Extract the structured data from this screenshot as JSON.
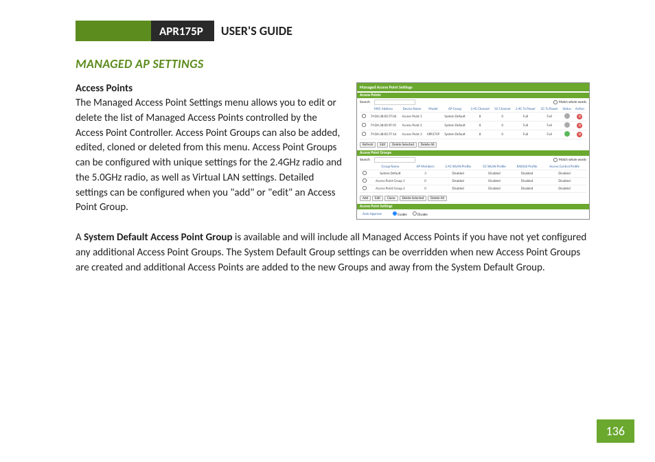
{
  "header": {
    "product": "APR175P",
    "title": "USER'S GUIDE"
  },
  "section_title": "MANAGED AP SETTINGS",
  "subhead": "Access Points",
  "para1": "The Managed Access Point Settings menu allows you to edit or delete the list of Managed Access Points controlled by the Access Point Controller. Access Point Groups can also be added, edited, cloned or deleted from this menu. Access Point Groups can be configured with unique settings for the 2.4GHz radio and the 5.0GHz radio, as well as Virtual LAN settings. Detailed settings can be configured when you \"add\" or \"edit\" an Access Point Group.",
  "para2_pre": "A ",
  "para2_bold": "System Default Access Point Group",
  "para2_post": " is available and will include all Managed Access Points if you have not yet configured any additional Access Point Groups. The System Default Group settings can be overridden when new Access Point Groups are created and additional Access Points are added to the new Groups and away from the System Default Group.",
  "page_number": "136",
  "ss": {
    "main_title": "Managed Access Point Settings",
    "ap_title": "Access Points",
    "search_label": "Search",
    "match_label": "Match whole words",
    "ap_headers": [
      "",
      "MAC Address",
      "Device Name",
      "Model",
      "AP Group",
      "2.4G Channel",
      "5G Channel",
      "2.4G Tx Power",
      "5G Tx Power",
      "Status",
      "Action"
    ],
    "ap_rows": [
      {
        "mac": "74:DA:38:00:7F:06",
        "name": "Access Point 1",
        "model": "",
        "group": "System Default",
        "c24": "8",
        "c5": "0",
        "p24": "Full",
        "p5": "Full",
        "status": "gray",
        "action": "red"
      },
      {
        "mac": "74:DA:38:00:9F:9C",
        "name": "Access Point 2",
        "model": "",
        "group": "System Default",
        "c24": "8",
        "c5": "0",
        "p24": "Full",
        "p5": "Full",
        "status": "gray",
        "action": "red"
      },
      {
        "mac": "74:DA:38:00:7F:16",
        "name": "Access Point 3",
        "model": "APR175P",
        "group": "System Default",
        "c24": "8",
        "c5": "0",
        "p24": "Full",
        "p5": "Full",
        "status": "green",
        "action": "red"
      }
    ],
    "ap_buttons": [
      "Refresh",
      "Edit",
      "Delete Selected",
      "Delete All"
    ],
    "grp_title": "Access Point Groups",
    "grp_headers": [
      "",
      "Group Name",
      "AP Members",
      "2.4G WLAN Profile",
      "5G WLAN Profile",
      "RADIUS Profile",
      "Access Control Profile"
    ],
    "grp_rows": [
      {
        "name": "System Default",
        "members": "3",
        "p24": "Disabled",
        "p5": "Disabled",
        "radius": "Disabled",
        "acl": "Disabled"
      },
      {
        "name": "Access Point Group 1",
        "members": "0",
        "p24": "Disabled",
        "p5": "Disabled",
        "radius": "Disabled",
        "acl": "Disabled"
      },
      {
        "name": "Access Point Group 2",
        "members": "0",
        "p24": "Disabled",
        "p5": "Disabled",
        "radius": "Disabled",
        "acl": "Disabled"
      }
    ],
    "grp_buttons": [
      "Add",
      "Edit",
      "Clone",
      "Delete Selected",
      "Delete All"
    ],
    "settings_title": "Access Point Settings",
    "auto_approve": "Auto Approve",
    "enable": "Enable",
    "disable": "Disable"
  }
}
